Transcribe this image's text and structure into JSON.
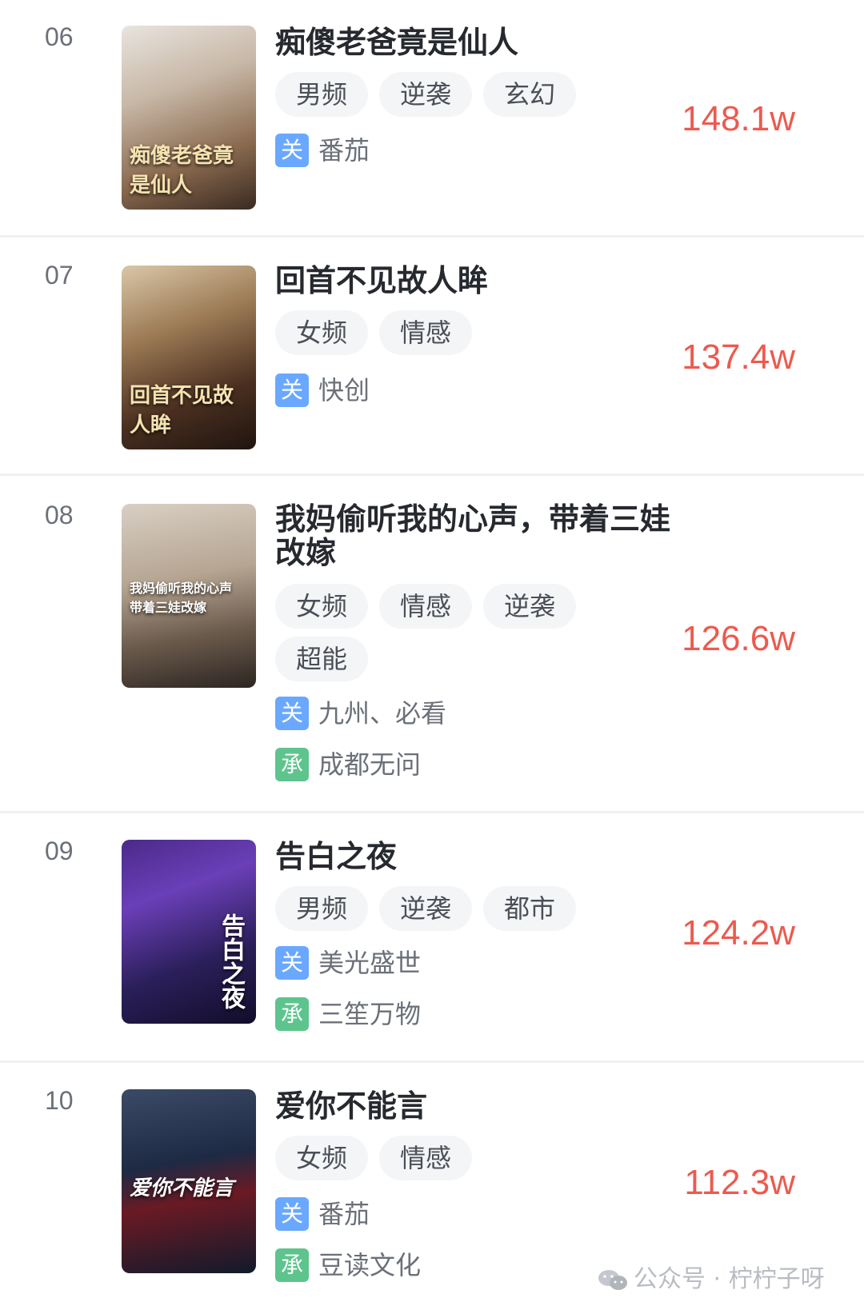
{
  "items": [
    {
      "rank": "06",
      "title": "痴傻老爸竟是仙人",
      "tags": [
        "男频",
        "逆袭",
        "玄幻"
      ],
      "guan": "番茄",
      "cheng": "",
      "score": "148.1w",
      "cover_caption": "痴傻老爸竟是仙人"
    },
    {
      "rank": "07",
      "title": "回首不见故人眸",
      "tags": [
        "女频",
        "情感"
      ],
      "guan": "快创",
      "cheng": "",
      "score": "137.4w",
      "cover_caption": "回首不见故人眸"
    },
    {
      "rank": "08",
      "title": "我妈偷听我的心声，带着三娃改嫁",
      "tags": [
        "女频",
        "情感",
        "逆袭",
        "超能"
      ],
      "guan": "九州、必看",
      "cheng": "成都无问",
      "score": "126.6w",
      "cover_caption": "我妈偷听我的心声 带着三娃改嫁"
    },
    {
      "rank": "09",
      "title": "告白之夜",
      "tags": [
        "男频",
        "逆袭",
        "都市"
      ],
      "guan": "美光盛世",
      "cheng": "三笙万物",
      "score": "124.2w",
      "cover_caption": "告白之夜"
    },
    {
      "rank": "10",
      "title": "爱你不能言",
      "tags": [
        "女频",
        "情感"
      ],
      "guan": "番茄",
      "cheng": "豆读文化",
      "score": "112.3w",
      "cover_caption": "爱你不能言"
    }
  ],
  "badges": {
    "guan": "关",
    "cheng": "承"
  },
  "watermark": "公众号 · 柠柠子呀",
  "colors": {
    "score": "#ec5a4f",
    "badge_guan": "#6aa8ff",
    "badge_cheng": "#5ec48d",
    "tag_bg": "#f4f5f7"
  }
}
